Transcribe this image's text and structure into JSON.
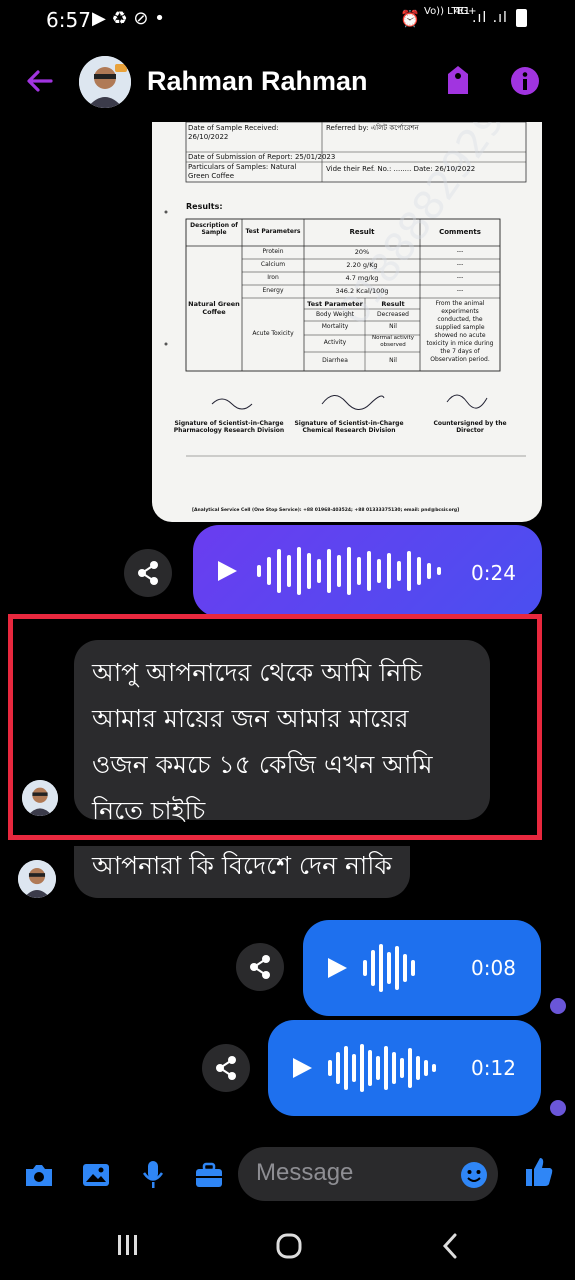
{
  "status": {
    "time": "6:57",
    "network": "4G+",
    "volte": "Vo)) LTE1"
  },
  "header": {
    "contact_name": "Rahman Rahman"
  },
  "document": {
    "line1": "Date of Sample Received: 26/10/2022",
    "line1b": "Referred by: এলিট কর্পোরেশন",
    "line2": "Date of Submission of Report: 25/01/2023",
    "line3": "Particulars of Samples: Natural Green Coffee",
    "line3b": "Vide their Ref. No.: ........ Date: 26/10/2022",
    "results": "Results:",
    "h_desc": "Description of Sample",
    "h_param": "Test Parameters",
    "h_result": "Result",
    "h_comments": "Comments",
    "sample": "Natural Green Coffee",
    "rows": [
      [
        "Protein",
        "20%",
        "---"
      ],
      [
        "Calcium",
        "2.20 g/Kg",
        "---"
      ],
      [
        "Iron",
        "4.7 mg/kg",
        "---"
      ],
      [
        "Energy",
        "346.2 Kcal/100g",
        "---"
      ]
    ],
    "tox_label": "Acute Toxicity",
    "tox_h1": "Test Parameter",
    "tox_h2": "Result",
    "tox_rows": [
      [
        "Body Weight",
        "Decreased"
      ],
      [
        "Mortality",
        "Nil"
      ],
      [
        "Activity",
        "Normal activity observed"
      ],
      [
        "Diarrhea",
        "Nil"
      ]
    ],
    "tox_comment": "From the animal experiments conducted, the supplied sample showed no acute toxicity in mice during the 7 days of Observation period.",
    "sig1": "Signature of Scientist-in-Charge Pharmacology Research Division",
    "sig2": "Signature of Scientist-in-Charge Chemical Research Division",
    "sig3": "Countersigned by the Director",
    "footer": "[Analytical Service Cell (One Stop Service): +88 01968-403524; +88 01333375130; email: pnd@bcsir.org]"
  },
  "messages": {
    "audio1_duration": "0:24",
    "text1": "আপু আপনাদের থেকে আমি নিচি আমার মায়ের জন আমার মায়ের ওজন কমচে ১৫ কেজি এখন আমি নিতে চাইচি",
    "text2": "আপনারা কি বিদেশে দেন নাকি",
    "audio2_duration": "0:08",
    "audio3_duration": "0:12"
  },
  "composer": {
    "placeholder": "Message"
  },
  "colors": {
    "accent": "#a134e0",
    "highlight": "#e8283e",
    "bubble_blue": "#1e70ee",
    "bubble_purple": "#6a3df0"
  }
}
